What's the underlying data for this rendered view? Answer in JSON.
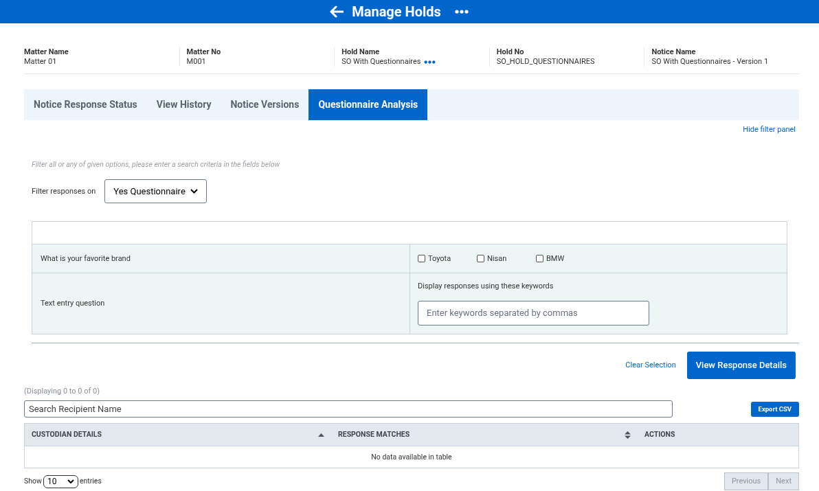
{
  "header": {
    "title": "Manage Holds"
  },
  "info": [
    {
      "label": "Matter Name",
      "value": "Matter 01",
      "more": false
    },
    {
      "label": "Matter No",
      "value": "M001",
      "more": false
    },
    {
      "label": "Hold Name",
      "value": "SO With Questionnaires",
      "more": true
    },
    {
      "label": "Hold No",
      "value": "SO_HOLD_QUESTIONNAIRES",
      "more": false
    },
    {
      "label": "Notice Name",
      "value": "SO With Questionnaires - Version 1",
      "more": false
    }
  ],
  "tabs": [
    {
      "label": "Notice Response Status",
      "selected": false
    },
    {
      "label": "View History",
      "selected": false
    },
    {
      "label": "Notice Versions",
      "selected": false
    },
    {
      "label": "Questionnaire Analysis",
      "selected": true
    }
  ],
  "hide_filter_link": "Hide filter panel",
  "filter": {
    "hint": "Filter all or any of given options, please enter a search criteria in the fields below",
    "label": "Filter responses on",
    "value": "Yes Questionnaire"
  },
  "questions": [
    {
      "kind": "choice",
      "text": "What is your favorite brand",
      "options": [
        {
          "label": "Toyota",
          "checked": false
        },
        {
          "label": "Nisan",
          "checked": false
        },
        {
          "label": "BMW",
          "checked": false
        }
      ]
    },
    {
      "kind": "text",
      "text": "Text entry question",
      "prompt": "Display responses using these keywords",
      "placeholder": "Enter keywords separated by commas"
    }
  ],
  "clear_selection": "Clear Selection",
  "view_button": "View Response Details",
  "displaying": "(Displaying 0 to 0 of 0)",
  "search": {
    "placeholder": "Search Recipient Name"
  },
  "export_button": "Export CSV",
  "table": {
    "columns": [
      {
        "label": "CUSTODIAN DETAILS",
        "kind": "ascending"
      },
      {
        "label": "RESPONSE MATCHES",
        "kind": "sortable"
      },
      {
        "label": "ACTIONS",
        "kind": "plain"
      }
    ],
    "empty": "No data available in table"
  },
  "length": {
    "before": "Show",
    "value": "10",
    "after": "entries"
  },
  "pager": [
    {
      "label": "Previous",
      "disabled": true
    },
    {
      "label": "Next",
      "disabled": true
    }
  ]
}
